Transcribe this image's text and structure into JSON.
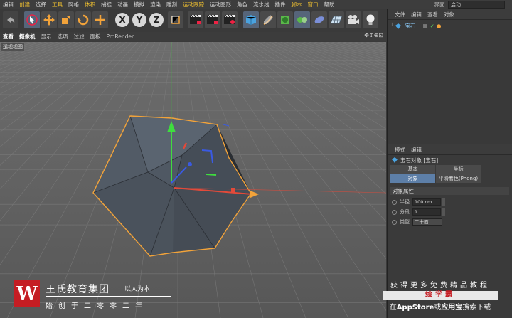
{
  "menubar": {
    "items": [
      "编辑",
      "创建",
      "选择",
      "工具",
      "网格",
      "体积",
      "捕捉",
      "动画",
      "模拟",
      "渲染",
      "雕刻",
      "运动跟踪",
      "运动图形",
      "角色",
      "流水线",
      "插件",
      "脚本",
      "窗口",
      "帮助"
    ],
    "layout_label": "界面:",
    "layout_value": "启动"
  },
  "toolbar": {
    "axis_x": "X",
    "axis_y": "Y",
    "axis_z": "Z"
  },
  "viewport": {
    "menu": [
      "查看",
      "摄像机",
      "显示",
      "选项",
      "过滤",
      "面板",
      "ProRender"
    ],
    "label": "透视视图",
    "nav_icons": "✥↕⊕⊡"
  },
  "object_manager": {
    "menu": [
      "文件",
      "编辑",
      "查看",
      "对象"
    ],
    "object_name": "宝石"
  },
  "attributes": {
    "menu": [
      "模式",
      "编辑"
    ],
    "title": "宝石对象 [宝石]",
    "tabs": [
      "基本",
      "坐标",
      "对象",
      "平滑着色(Phong)"
    ],
    "section": "对象属性",
    "radius_label": "半径",
    "radius_value": "100 cm",
    "segments_label": "分段",
    "segments_value": "1",
    "type_label": "类型",
    "type_value": "二十面"
  },
  "watermark_left": {
    "logo": "W",
    "name": "王氏教育集团",
    "slogan": "以人为本",
    "since": "始创于二零零二年"
  },
  "watermark_right": {
    "line1": "获得更多免费精品教程",
    "line2": "绘学霸",
    "line3_a": "在",
    "line3_b": "AppStore",
    "line3_c": "或",
    "line3_d": "应用宝",
    "line3_e": "搜索下载"
  },
  "colors": {
    "accent_orange": "#f2a33a",
    "selection_blue": "#5d7fa8",
    "menu_highlight": "#f2c230",
    "brand_red": "#c51d23"
  }
}
